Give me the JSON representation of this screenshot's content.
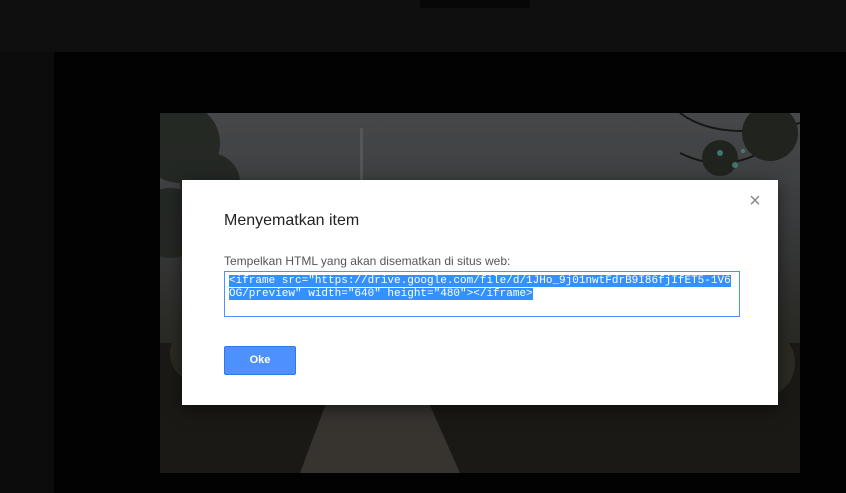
{
  "dialog": {
    "title": "Menyematkan item",
    "prompt": "Tempelkan HTML yang akan disematkan di situs web:",
    "embed_code": "<iframe src=\"https://drive.google.com/file/d/1JHo_9j01nwtFdrB9I86fjIfET5-1V6OG/preview\" width=\"640\" height=\"480\"></iframe>",
    "ok_label": "Oke",
    "close_icon": "×"
  },
  "colors": {
    "accent": "#4d90fe",
    "selection": "#3390ff",
    "backdrop": "#111111"
  }
}
